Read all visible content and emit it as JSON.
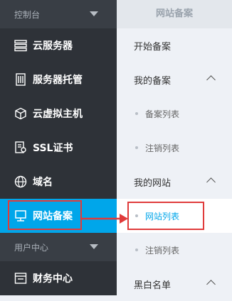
{
  "sidebar": {
    "group1_label": "控制台",
    "group2_label": "用户中心",
    "items": [
      {
        "label": "云服务器",
        "icon": "server-icon"
      },
      {
        "label": "服务器托管",
        "icon": "server-hosting-icon"
      },
      {
        "label": "云虚拟主机",
        "icon": "cube-icon"
      },
      {
        "label": "SSL证书",
        "icon": "certificate-icon"
      },
      {
        "label": "域名",
        "icon": "globe-icon"
      },
      {
        "label": "网站备案",
        "icon": "monitor-icon"
      }
    ],
    "finance": {
      "label": "财务中心",
      "icon": "finance-icon"
    }
  },
  "submenu": {
    "title": "网站备案",
    "start": "开始备案",
    "my_filing": "我的备案",
    "filing_list": "备案列表",
    "cancel_list_1": "注销列表",
    "my_sites": "我的网站",
    "site_list": "网站列表",
    "cancel_list_2": "注销列表",
    "blacklist": "黑白名单"
  },
  "colors": {
    "sidebar_bg": "#2e3238",
    "active": "#00a6ea",
    "highlight": "#e03b3b"
  }
}
